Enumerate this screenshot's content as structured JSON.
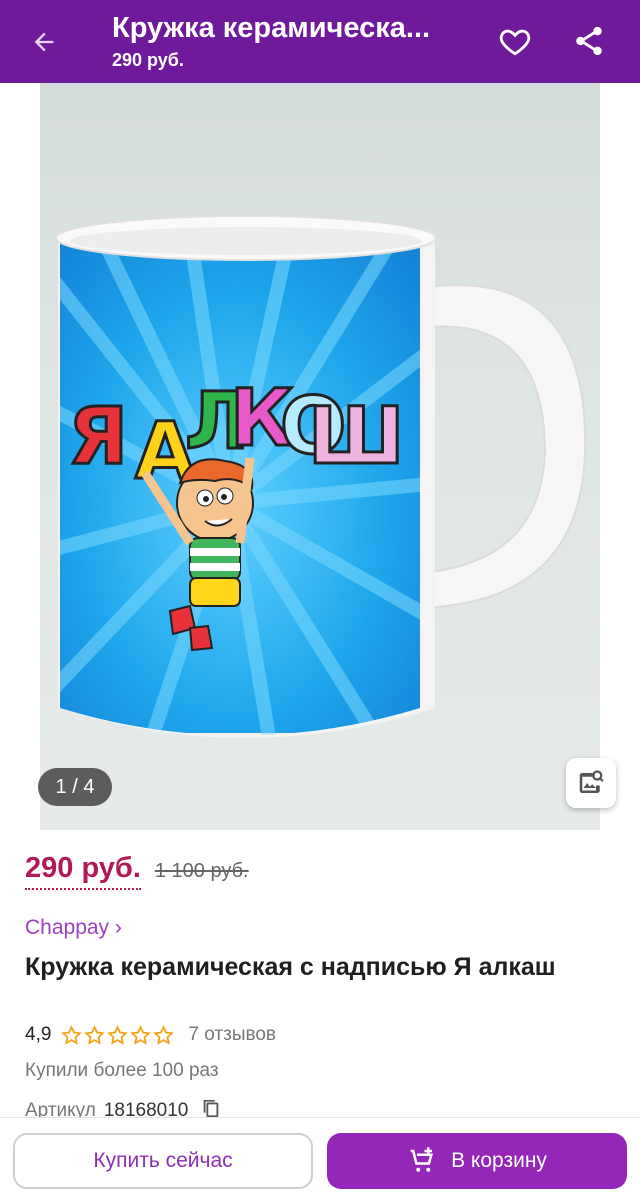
{
  "appbar": {
    "title": "Кружка керамическа...",
    "subtitle": "290 руб.",
    "back_icon": "arrow-left-icon",
    "favorite_icon": "heart-outline-icon",
    "share_icon": "share-icon"
  },
  "gallery": {
    "mug_text": "Я АЛКОШ",
    "pager": "1 / 4",
    "search_icon": "image-search-icon"
  },
  "product": {
    "price": "290 руб.",
    "old_price": "1 100 руб.",
    "brand": "Chappay ›",
    "title": "Кружка керамическая с надписью Я алкаш",
    "rating": "4,9",
    "stars_filled": 5,
    "reviews": "7 отзывов",
    "bought": "Купили более 100 раз",
    "article_label": "Артикул",
    "article_number": "18168010"
  },
  "actions": {
    "buy_now": "Купить сейчас",
    "add_to_cart": "В корзину"
  },
  "colors": {
    "appbar": "#6f1a9a",
    "price": "#b0195a",
    "brand": "#9e3fc0",
    "cart_button": "#9426b8",
    "star": "#f2a215"
  }
}
